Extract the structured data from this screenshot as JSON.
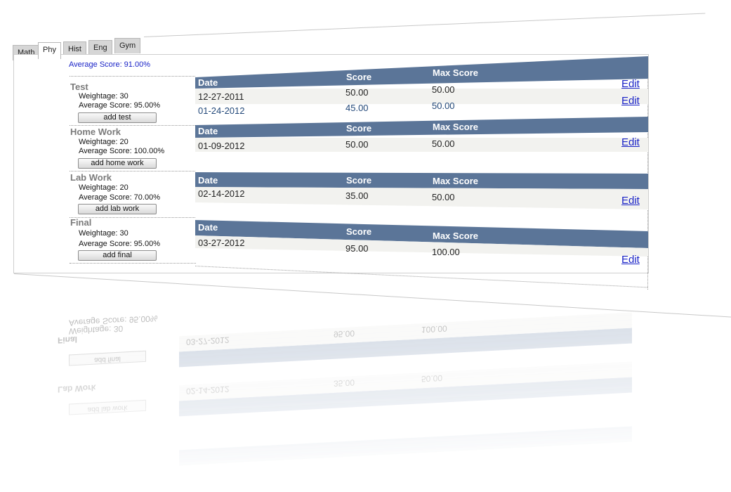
{
  "tabs": [
    {
      "label": "Math"
    },
    {
      "label": "Phy"
    },
    {
      "label": "Hist"
    },
    {
      "label": "Eng"
    },
    {
      "label": "Gym"
    }
  ],
  "average_score": "Average Score: 91.00%",
  "columns": {
    "date": "Date",
    "score": "Score",
    "max_score": "Max Score"
  },
  "edit_label": "Edit",
  "sections": [
    {
      "title": "Test",
      "weightage": "Weightage: 30",
      "average": "Average Score: 95.00%",
      "add_label": "add test",
      "rows": [
        {
          "date": "12-27-2011",
          "score": "50.00",
          "max": "50.00"
        },
        {
          "date": "01-24-2012",
          "score": "45.00",
          "max": "50.00"
        }
      ]
    },
    {
      "title": "Home Work",
      "weightage": "Weightage: 20",
      "average": "Average Score: 100.00%",
      "add_label": "add home work",
      "rows": [
        {
          "date": "01-09-2012",
          "score": "50.00",
          "max": "50.00"
        }
      ]
    },
    {
      "title": "Lab Work",
      "weightage": "Weightage: 20",
      "average": "Average Score: 70.00%",
      "add_label": "add lab work",
      "rows": [
        {
          "date": "02-14-2012",
          "score": "35.00",
          "max": "50.00"
        }
      ]
    },
    {
      "title": "Final",
      "weightage": "Weightage: 30",
      "average": "Average Score: 95.00%",
      "add_label": "add final",
      "rows": [
        {
          "date": "03-27-2012",
          "score": "95.00",
          "max": "100.00"
        }
      ]
    }
  ]
}
